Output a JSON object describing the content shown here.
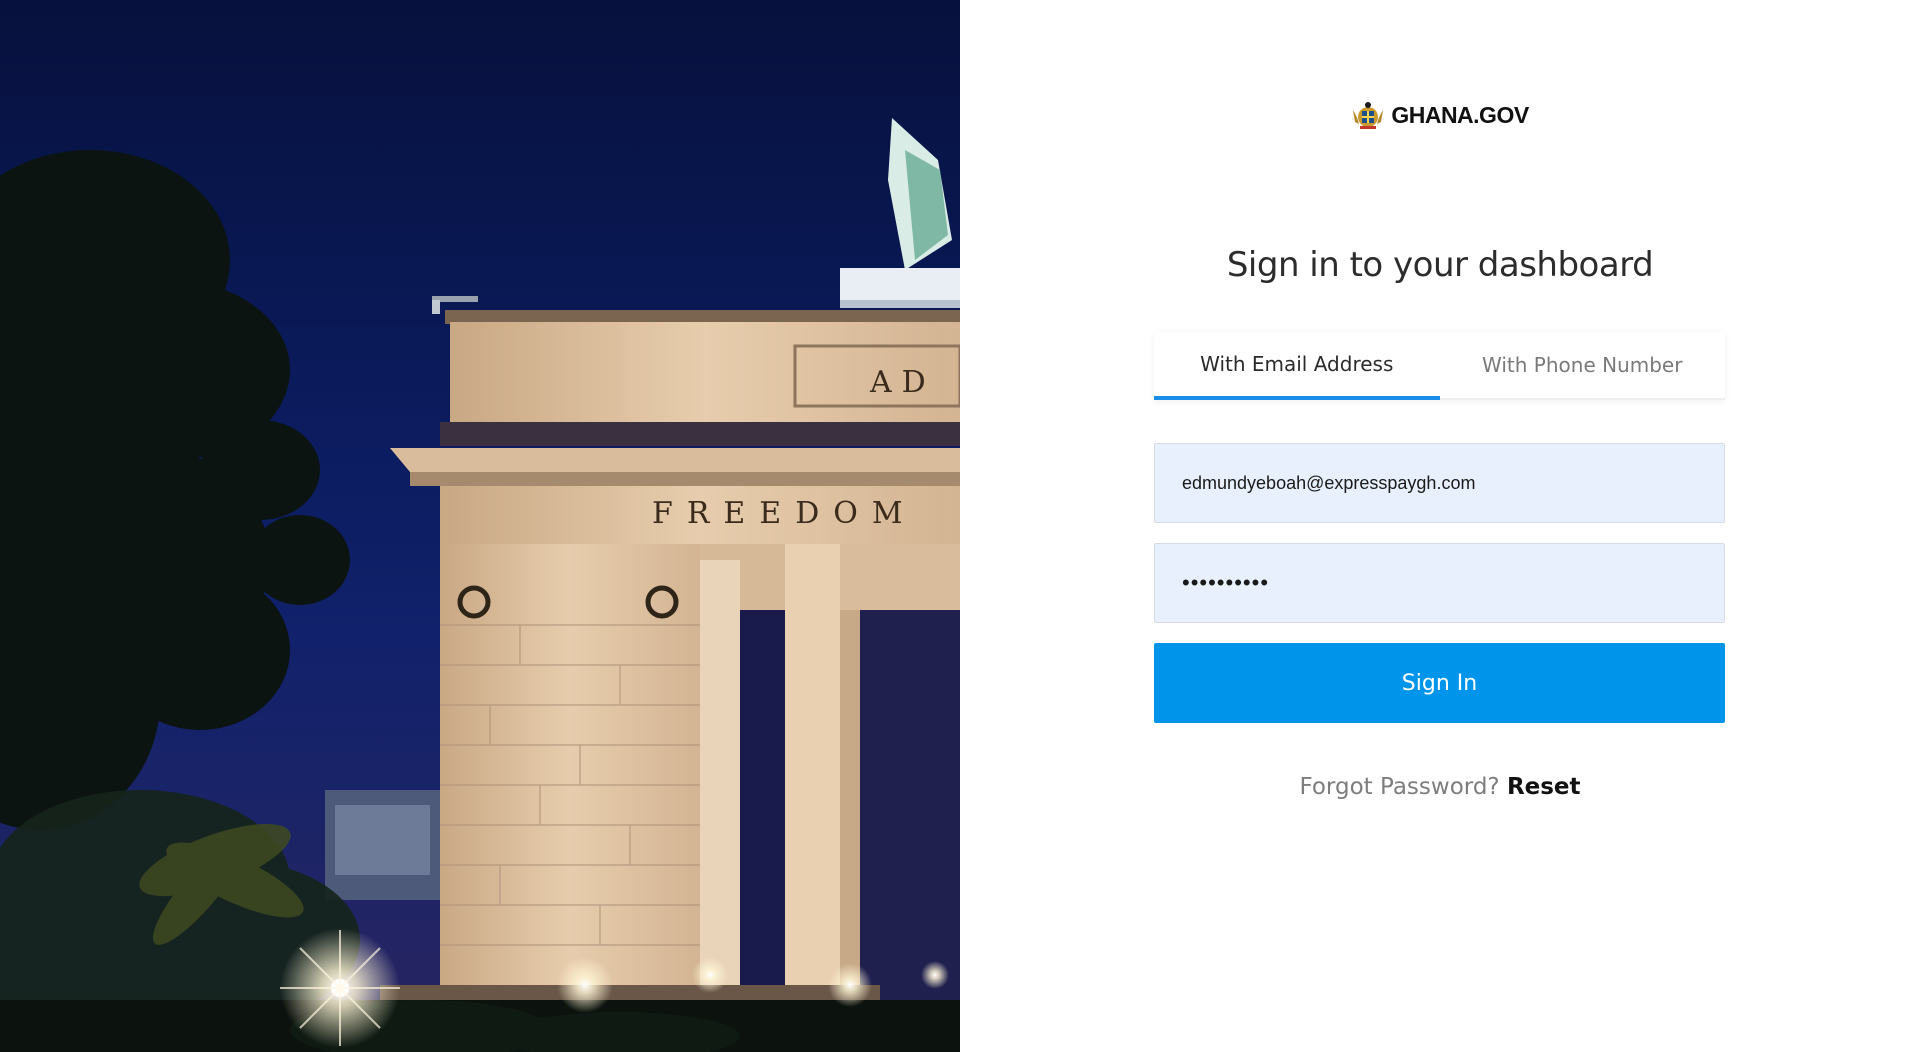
{
  "hero": {
    "monument_inscriptions": [
      "AD",
      "FREEDOM"
    ]
  },
  "brand": {
    "name": "GHANA.GOV",
    "crest_icon": "coat-of-arms-icon"
  },
  "heading": "Sign in to your dashboard",
  "tabs": [
    {
      "label": "With Email Address",
      "active": true
    },
    {
      "label": "With Phone Number",
      "active": false
    }
  ],
  "form": {
    "email_value": "edmundyeboah@expresspaygh.com",
    "password_value": "••••••••••",
    "submit_label": "Sign In"
  },
  "forgot": {
    "prompt": "Forgot Password?",
    "link_label": "Reset"
  },
  "colors": {
    "accent": "#0095ea",
    "tab_indicator": "#1a8ee6",
    "input_background": "#e8f0fe"
  }
}
